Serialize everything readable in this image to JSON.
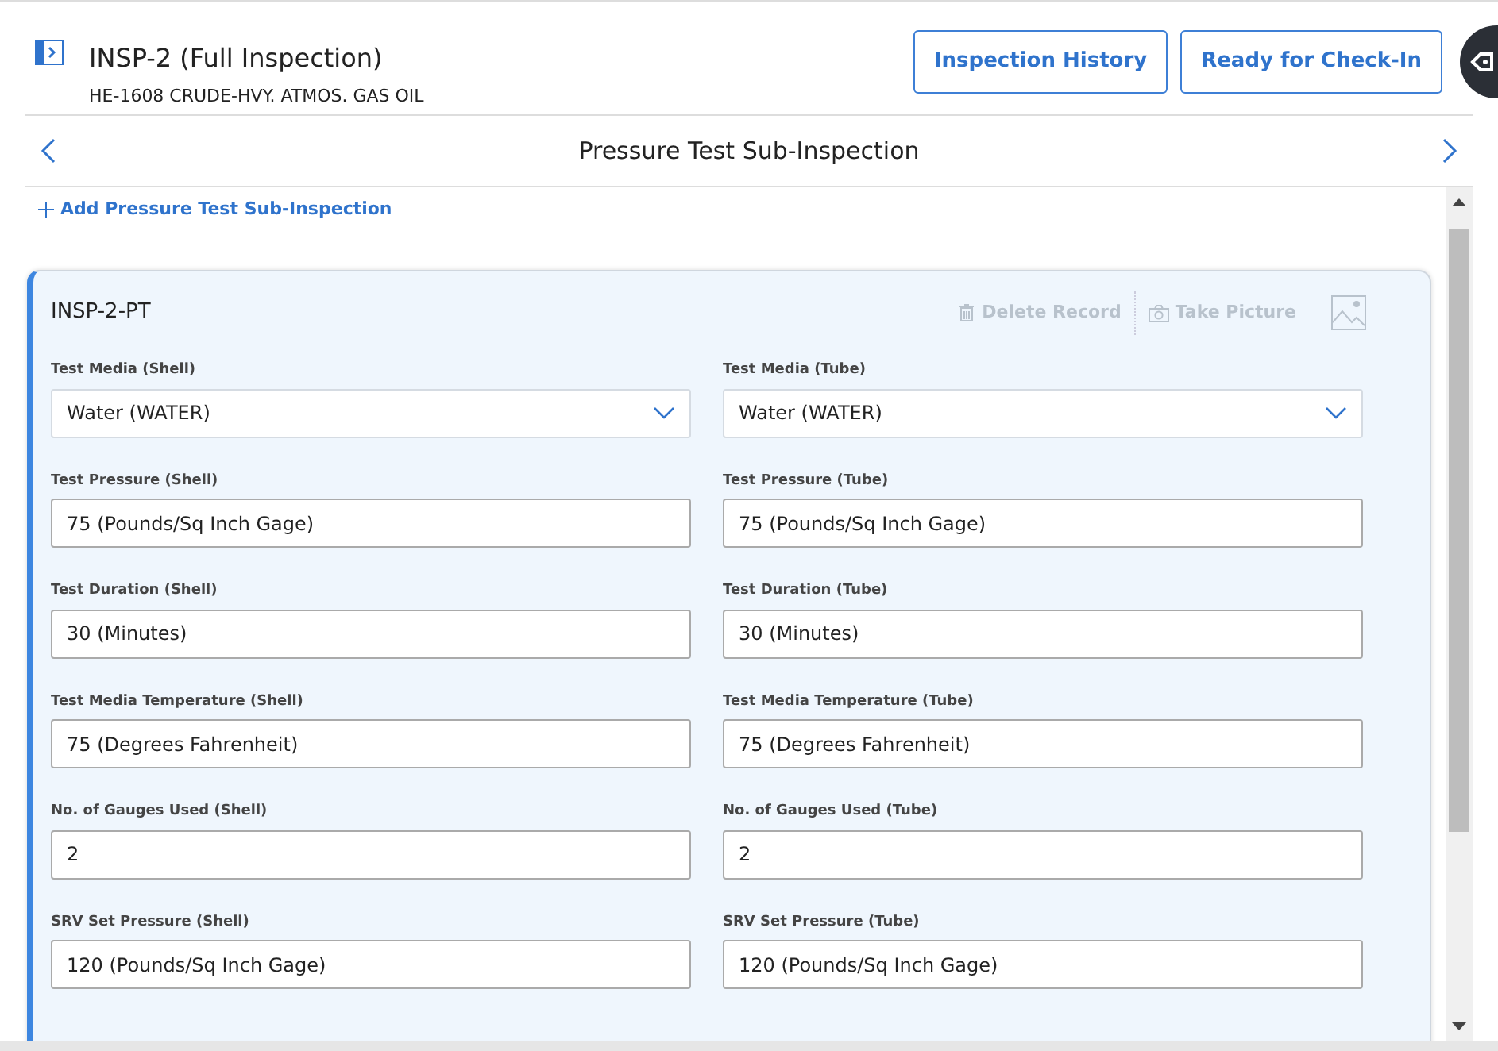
{
  "header": {
    "title": "INSP-2 (Full Inspection)",
    "subtitle": "HE-1608 CRUDE-HVY. ATMOS. GAS OIL",
    "buttons": [
      "Inspection History",
      "Ready for Check-In"
    ]
  },
  "nav": {
    "title": "Pressure Test Sub-Inspection"
  },
  "add_link": "Add Pressure Test Sub-Inspection",
  "record": {
    "title": "INSP-2-PT",
    "actions": [
      {
        "label": "Delete Record",
        "disabled": true
      },
      {
        "label": "Take Picture",
        "disabled": true
      }
    ],
    "fields": [
      {
        "label": "Test Media (Shell)",
        "value": "Water (WATER)",
        "kind": "select"
      },
      {
        "label": "Test Media (Tube)",
        "value": "Water (WATER)",
        "kind": "select"
      },
      {
        "label": "Test Pressure (Shell)",
        "value": "75 (Pounds/Sq Inch Gage)",
        "kind": "text"
      },
      {
        "label": "Test Pressure (Tube)",
        "value": "75 (Pounds/Sq Inch Gage)",
        "kind": "text"
      },
      {
        "label": "Test Duration (Shell)",
        "value": "30 (Minutes)",
        "kind": "text"
      },
      {
        "label": "Test Duration (Tube)",
        "value": "30 (Minutes)",
        "kind": "text"
      },
      {
        "label": "Test Media Temperature (Shell)",
        "value": "75 (Degrees Fahrenheit)",
        "kind": "text"
      },
      {
        "label": "Test Media Temperature (Tube)",
        "value": "75 (Degrees Fahrenheit)",
        "kind": "text"
      },
      {
        "label": "No. of Gauges Used (Shell)",
        "value": "2",
        "kind": "text"
      },
      {
        "label": "No. of Gauges Used (Tube)",
        "value": "2",
        "kind": "text"
      },
      {
        "label": "SRV Set Pressure (Shell)",
        "value": "120 (Pounds/Sq Inch Gage)",
        "kind": "text"
      },
      {
        "label": "SRV Set Pressure (Tube)",
        "value": "120 (Pounds/Sq Inch Gage)",
        "kind": "text"
      }
    ]
  }
}
